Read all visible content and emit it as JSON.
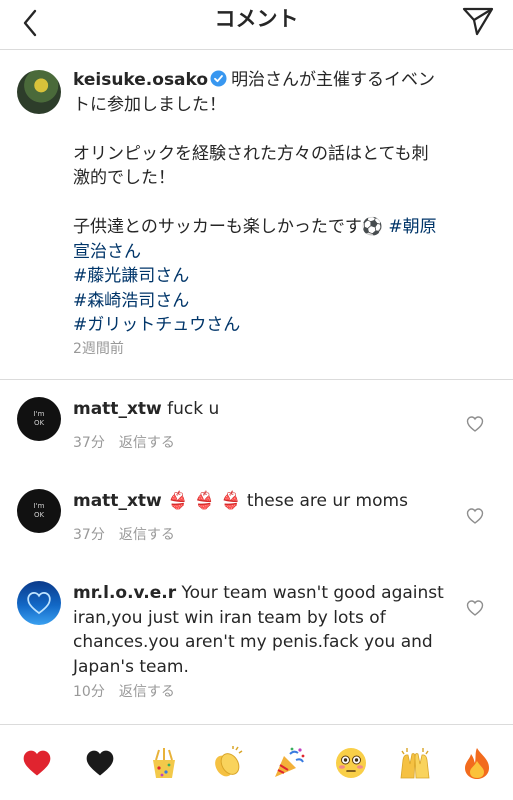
{
  "header": {
    "title": "コメント",
    "back_icon": "chevron-left-icon",
    "send_icon": "paper-plane-icon"
  },
  "caption": {
    "username": "keisuke.osako",
    "verified_icon": "verified-badge-icon",
    "paragraphs": [
      "明治さんが主催するイベントに参加しました！",
      "オリンピックを経験された方々の話はとても刺激的でした！",
      "子供達とのサッカーも楽しかったです⚽"
    ],
    "hashtags": [
      "#朝原宣治さん",
      "#藤光謙司さん",
      "#森崎浩司さん",
      "#ガリットチュウさん"
    ],
    "time": "2週間前"
  },
  "comments": [
    {
      "username": "matt_xtw",
      "avatar_text": [
        "I'm",
        "OK"
      ],
      "text": "fuck u",
      "time": "37分",
      "reply_label": "返信する"
    },
    {
      "username": "matt_xtw",
      "avatar_text": [
        "I'm",
        "OK"
      ],
      "text": "👙 👙 👙 these are ur moms",
      "time": "37分",
      "reply_label": "返信する"
    },
    {
      "username": "mr.l.o.v.e.r",
      "avatar_icon": "heart-outline-icon",
      "text": "Your team wasn't good against iran,you just win iran team by lots of chances.you aren't my penis.fack you and Japan's team.",
      "time": "10分",
      "reply_label": "返信する"
    }
  ],
  "emoji_bar": [
    "❤️",
    "🖤",
    "🎊",
    "👏",
    "🎉",
    "😳",
    "🙌",
    "🔥"
  ],
  "colors": {
    "text": "#262626",
    "secondary": "#999999",
    "hashtag": "#003569",
    "divider": "#dbdbdb",
    "verified": "#3897f0"
  }
}
